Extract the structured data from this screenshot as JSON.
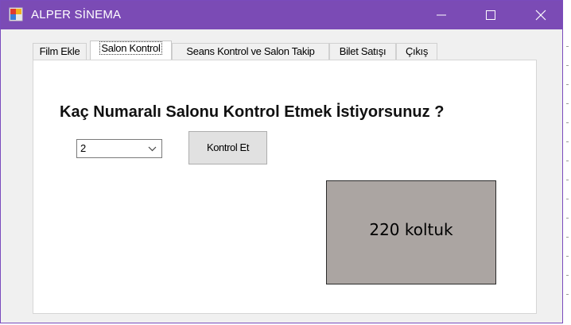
{
  "window": {
    "title": "ALPER SİNEMA",
    "titlebar_color": "#7b4bb5",
    "controls": [
      "minimize-icon",
      "maximize-icon",
      "close-icon"
    ]
  },
  "tabs": [
    {
      "label": "Film Ekle",
      "active": false
    },
    {
      "label": "Salon Kontrol",
      "active": true
    },
    {
      "label": "Seans Kontrol ve Salon Takip",
      "active": false
    },
    {
      "label": "Bilet Satışı",
      "active": false
    },
    {
      "label": "Çıkış",
      "active": false
    }
  ],
  "salon_kontrol": {
    "question": "Kaç Numaralı Salonu Kontrol Etmek İstiyorsunuz ?",
    "salon_select": {
      "value": "2"
    },
    "kontrol_button": "Kontrol Et",
    "result_panel": {
      "text": "220 koltuk",
      "color": "#aba5a2"
    }
  }
}
